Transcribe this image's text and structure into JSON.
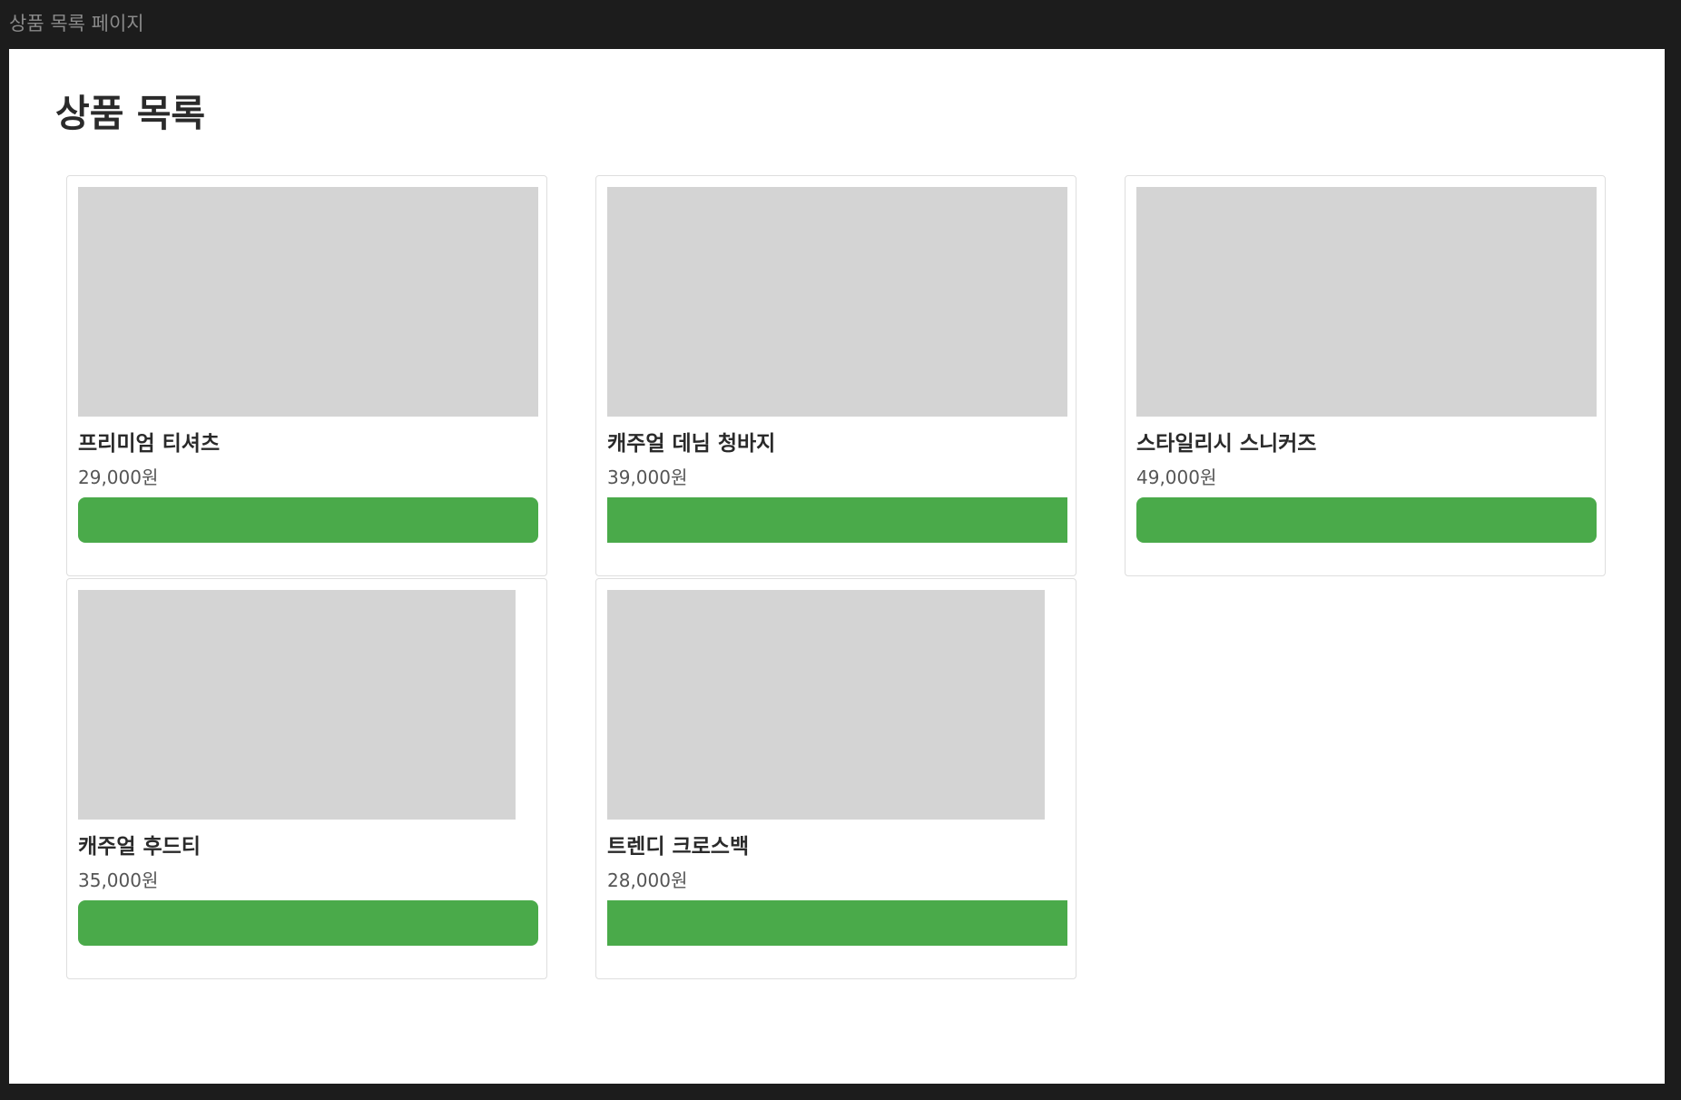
{
  "window": {
    "title": "상품 목록 페이지"
  },
  "page": {
    "heading": "상품 목록"
  },
  "colors": {
    "button": "#4aaa4a",
    "image_placeholder": "#d4d4d4",
    "card_border": "#dedede"
  },
  "products": [
    {
      "name": "프리미엄 티셔츠",
      "price": "29,000원",
      "button_label": ""
    },
    {
      "name": "캐주얼 데님 청바지",
      "price": "39,000원",
      "button_label": ""
    },
    {
      "name": "스타일리시 스니커즈",
      "price": "49,000원",
      "button_label": ""
    },
    {
      "name": "캐주얼 후드티",
      "price": "35,000원",
      "button_label": ""
    },
    {
      "name": "트렌디 크로스백",
      "price": "28,000원",
      "button_label": ""
    }
  ]
}
